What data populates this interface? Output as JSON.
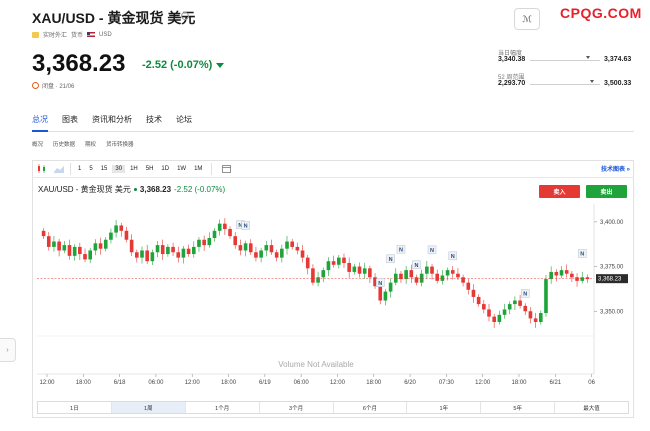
{
  "header": {
    "title": "XAU/USD - 黄金现货 美元",
    "meta_type": "实时外汇",
    "meta_currency_label": "货币",
    "meta_currency": "USD",
    "price": "3,368.23",
    "change": "-2.52 (-0.07%)",
    "closed": "闭盘 · 21/06",
    "logo": "CPQG.COM",
    "icon_label": "ℳ"
  },
  "ranges": {
    "day_label": "当日幅度",
    "day_low": "3,340.38",
    "day_high": "3,374.63",
    "week52_label": "52 周范围",
    "week52_low": "2,293.70",
    "week52_high": "3,500.33"
  },
  "tabs": [
    "总况",
    "图表",
    "资讯和分析",
    "技术",
    "论坛"
  ],
  "subtabs": [
    "概况",
    "历史数据",
    "期权",
    "货币转换器"
  ],
  "toolbar": {
    "timeframes": [
      "1",
      "5",
      "15",
      "30",
      "1H",
      "5H",
      "1D",
      "1W",
      "1M"
    ],
    "active_timeframe": "30",
    "tech_link": "技术图表 »"
  },
  "chart_header": {
    "symbol": "XAU/USD - 黄金现货 美元",
    "value": "3,368.23",
    "change": "-2.52 (-0.07%)",
    "sell": "卖入",
    "buy": "卖出"
  },
  "chart_data": {
    "type": "candlestick",
    "ylim": [
      3330,
      3410
    ],
    "y_ticks": [
      "3,400.00",
      "3,375.00",
      "3,350.00"
    ],
    "y_tick_values": [
      3400,
      3375,
      3350
    ],
    "x_ticks": [
      "12:00",
      "18:00",
      "6/18",
      "06:00",
      "12:00",
      "18:00",
      "6/19",
      "06:00",
      "12:00",
      "18:00",
      "6/20",
      "07:30",
      "12:00",
      "18:00",
      "6/21",
      "06"
    ],
    "last_price": 3368.23,
    "last_price_label": "3,368.23",
    "volume_note": "Volume Not Available",
    "news_marker_label": "N",
    "close": [
      3392,
      3386,
      3389,
      3384,
      3387,
      3381,
      3386,
      3382,
      3379,
      3384,
      3388,
      3385,
      3390,
      3394,
      3398,
      3395,
      3390,
      3383,
      3380,
      3384,
      3378,
      3383,
      3387,
      3382,
      3386,
      3383,
      3380,
      3385,
      3382,
      3386,
      3390,
      3387,
      3391,
      3395,
      3399,
      3396,
      3392,
      3387,
      3384,
      3388,
      3383,
      3380,
      3384,
      3387,
      3383,
      3380,
      3385,
      3389,
      3386,
      3384,
      3380,
      3374,
      3366,
      3369,
      3373,
      3378,
      3376,
      3380,
      3377,
      3372,
      3375,
      3371,
      3374,
      3369,
      3364,
      3356,
      3361,
      3366,
      3371,
      3368,
      3373,
      3369,
      3366,
      3371,
      3375,
      3371,
      3367,
      3370,
      3373,
      3371,
      3369,
      3366,
      3362,
      3358,
      3354,
      3351,
      3347,
      3344,
      3348,
      3351,
      3354,
      3356,
      3353,
      3350,
      3346,
      3344,
      3349,
      3368,
      3372,
      3370,
      3373,
      3371,
      3369,
      3367,
      3369,
      3368
    ]
  },
  "range_bar": [
    "1日",
    "1周",
    "1个月",
    "3个月",
    "6个月",
    "1年",
    "5年",
    "最大值"
  ],
  "range_bar_active": "1周"
}
